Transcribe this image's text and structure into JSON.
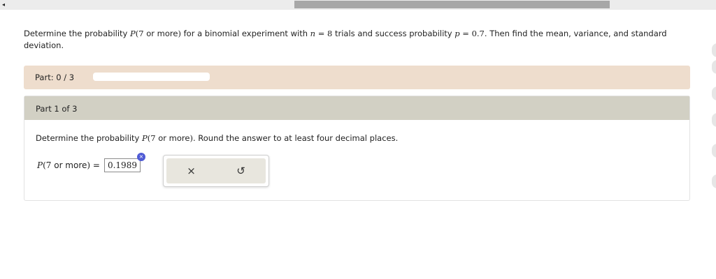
{
  "top_bar": {
    "arrow_icon": "caret-left-icon"
  },
  "question": {
    "text_before": "Determine the probability ",
    "prob_symbol": "P",
    "prob_open": "(",
    "prob_num": "7",
    "prob_text": " or more",
    "prob_close": ")",
    "text_mid": " for a binomial experiment with ",
    "n_symbol": "n",
    "n_eq": " = 8",
    "text_trials": " trials and success probability ",
    "p_symbol": "p",
    "p_eq": " = 0.7",
    "text_after": ". Then find the mean, variance, and standard deviation."
  },
  "progress": {
    "label": "Part: 0 / 3",
    "fraction": 0.0,
    "fill_color": "#6a9e3a"
  },
  "part": {
    "title": "Part 1 of 3",
    "question_before": "Determine the probability ",
    "prob_symbol": "P",
    "prob_open": "(",
    "prob_num": "7",
    "prob_text": " or more",
    "prob_close": ")",
    "question_after": ". Round the answer to at least four decimal places."
  },
  "answer": {
    "label_symbol": "P",
    "label_open": "(",
    "label_num": "7",
    "label_text": " or more",
    "label_close": ")",
    "label_eq": " = ",
    "value": "0.1989",
    "error_icon": "x-circle-icon",
    "error_glyph": "×"
  },
  "buttons": {
    "clear_glyph": "×",
    "clear_icon": "close-icon",
    "undo_glyph": "↺",
    "undo_icon": "undo-icon"
  },
  "colors": {
    "progress_bg": "#eeddcd",
    "part_header_bg": "#d2d0c4",
    "error_badge": "#4f5bd5"
  }
}
